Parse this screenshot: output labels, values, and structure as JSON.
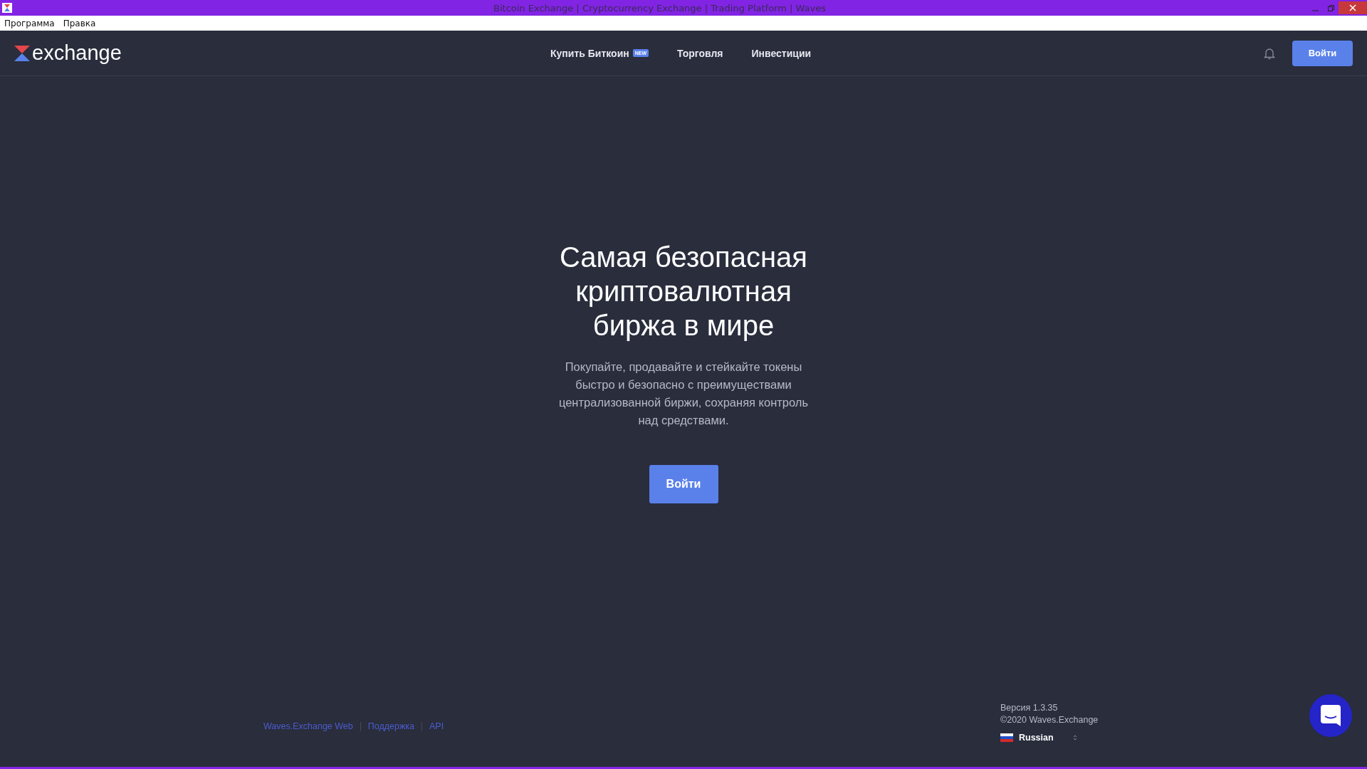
{
  "window": {
    "title": "Bitcoin Exchange | Cryptocurrency Exchange | Trading Platform | Waves"
  },
  "menu_bar": [
    "Программа",
    "Правка"
  ],
  "header": {
    "logo": "exchange",
    "nav": [
      {
        "label": "Купить Биткоин",
        "badge": "NEW"
      },
      {
        "label": "Торговля"
      },
      {
        "label": "Инвестиции"
      }
    ],
    "login": "Войти"
  },
  "hero": {
    "title": "Самая безопасная криптовалютная биржа в мире",
    "text": "Покупайте, продавайте и стейкайте токены быстро и безопасно с преимуществами централизованной биржи, сохраняя контроль над средствами.",
    "button": "Войти"
  },
  "footer": {
    "links": [
      "Waves.Exchange Web",
      "Поддержка",
      "API"
    ],
    "version": "Версия 1.3.35",
    "copyright": "©2020 Waves.Exchange",
    "language": "Russian"
  }
}
